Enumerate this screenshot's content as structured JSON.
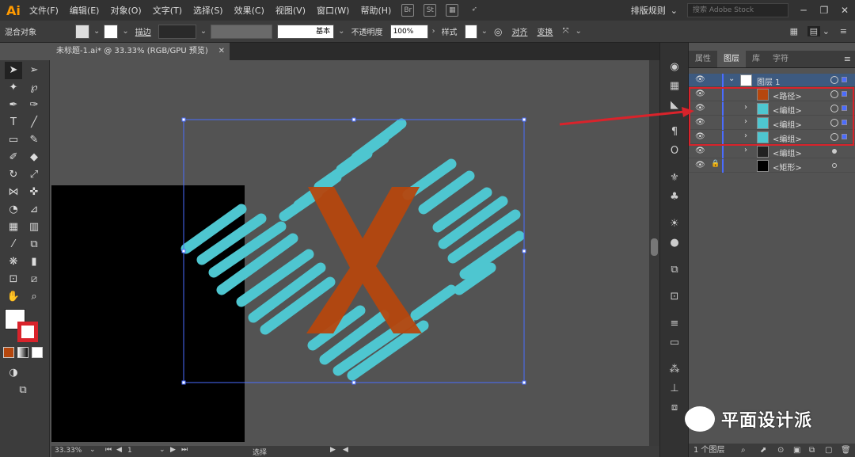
{
  "app": {
    "logo": "Ai"
  },
  "menu": [
    "文件(F)",
    "编辑(E)",
    "对象(O)",
    "文字(T)",
    "选择(S)",
    "效果(C)",
    "视图(V)",
    "窗口(W)",
    "帮助(H)"
  ],
  "workspace": "排版规则",
  "search_placeholder": "搜索 Adobe Stock",
  "control": {
    "mode": "混合对象",
    "stroke_label": "描边",
    "stroke_style": "基本",
    "opacity_label": "不透明度",
    "opacity_value": "100%",
    "style_label": "样式",
    "align": "对齐",
    "transform": "变换"
  },
  "document": {
    "tab": "未标题-1.ai* @ 33.33% (RGB/GPU 预览)"
  },
  "status": {
    "zoom": "33.33%",
    "page": "1",
    "mode": "选择"
  },
  "layers_panel": {
    "tabs": [
      "属性",
      "图层",
      "库",
      "字符"
    ],
    "active_tab": "图层",
    "rows": [
      {
        "name": "图层 1",
        "type": "layer"
      },
      {
        "name": "<路径>",
        "type": "path"
      },
      {
        "name": "<编组>",
        "type": "group"
      },
      {
        "name": "<编组>",
        "type": "group"
      },
      {
        "name": "<编组>",
        "type": "group"
      },
      {
        "name": "<编组>",
        "type": "group"
      },
      {
        "name": "<矩形>",
        "type": "rect"
      }
    ],
    "footer": "1 个图层"
  },
  "watermark": "平面设计派",
  "colors": {
    "accent_teal": "#4ec6d0",
    "x_orange": "#b5470e",
    "highlight_red": "#d9232b",
    "selection_blue": "#4a6cff"
  }
}
